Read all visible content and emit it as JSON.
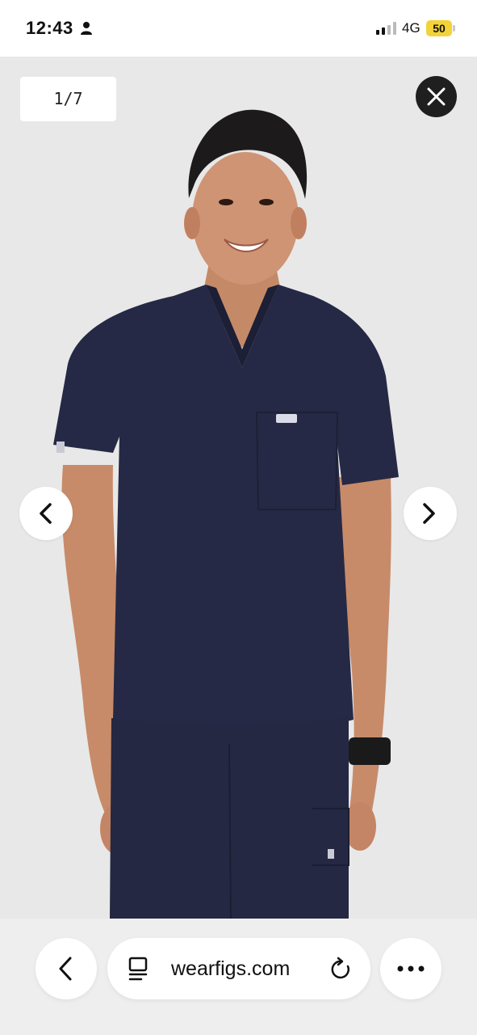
{
  "status_bar": {
    "time": "12:43",
    "network": "4G",
    "battery": "50",
    "person_icon": "person-icon",
    "signal_icon": "signal-bars-icon"
  },
  "gallery": {
    "counter": "1/7",
    "image_description_icon": "product-photo",
    "close_icon": "close-icon",
    "prev_icon": "chevron-left-icon",
    "next_icon": "chevron-right-icon"
  },
  "browser": {
    "url": "wearfigs.com",
    "back_icon": "chevron-left-icon",
    "page_icon": "page-info-icon",
    "reload_icon": "reload-icon",
    "more_icon": "more-dots-icon"
  },
  "colors": {
    "gallery_bg": "#e8e8e8",
    "scrub_navy": "#252945",
    "battery_yellow": "#f3d23a",
    "close_button": "#1f1f1f"
  }
}
